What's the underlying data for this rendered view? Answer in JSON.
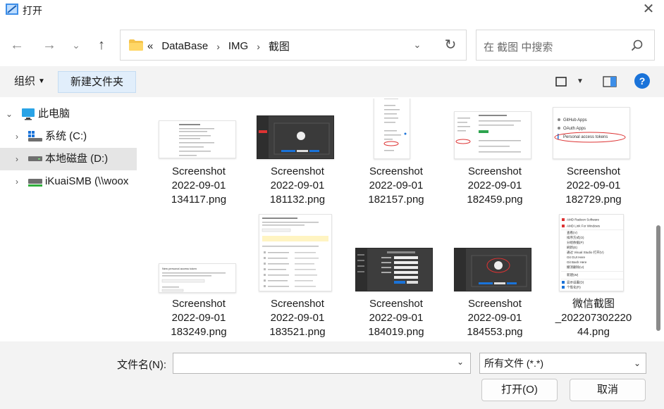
{
  "window": {
    "title": "打开",
    "close_glyph": "✕"
  },
  "nav_buttons": {
    "back": "←",
    "forward": "→",
    "recent": "⌄",
    "up": "↑"
  },
  "address": {
    "overflow": "«",
    "crumbs": [
      "DataBase",
      "IMG",
      "截图"
    ],
    "separator": "›",
    "refresh": "↻"
  },
  "search": {
    "placeholder": "在 截图 中搜索"
  },
  "toolbar": {
    "organize": "组织",
    "new_folder": "新建文件夹",
    "help": "?"
  },
  "sidebar": {
    "items": [
      {
        "label": "此电脑",
        "icon": "monitor-icon",
        "expanded": true
      },
      {
        "label": "系统 (C:)",
        "icon": "windows-drive-icon"
      },
      {
        "label": "本地磁盘 (D:)",
        "icon": "drive-icon",
        "selected": true
      },
      {
        "label": "iKuaiSMB (\\\\woox",
        "icon": "network-drive-icon"
      }
    ],
    "arrow_expanded": "⌄",
    "arrow_collapsed": "›"
  },
  "files": [
    {
      "name": "Screenshot\n2022-09-01\n134117.png",
      "style": "light-form"
    },
    {
      "name": "Screenshot\n2022-09-01\n181132.png",
      "style": "dark-dialog"
    },
    {
      "name": "Screenshot\n2022-09-01\n182157.png",
      "style": "menu-list"
    },
    {
      "name": "Screenshot\n2022-09-01\n182459.png",
      "style": "light-settings"
    },
    {
      "name": "Screenshot\n2022-09-01\n182729.png",
      "style": "github-menu"
    },
    {
      "name": "Screenshot\n2022-09-01\n183249.png",
      "style": "light-token"
    },
    {
      "name": "Screenshot\n2022-09-01\n183521.png",
      "style": "light-long"
    },
    {
      "name": "Screenshot\n2022-09-01\n184019.png",
      "style": "dark-form"
    },
    {
      "name": "Screenshot\n2022-09-01\n184553.png",
      "style": "dark-dialog"
    },
    {
      "name": "微信截图\n_202207302220\n44.png",
      "style": "context-menu"
    }
  ],
  "thumb_text": {
    "github_apps": "GitHub Apps",
    "oauth_apps": "OAuth Apps",
    "personal_tokens": "Personal access tokens",
    "token_title": "New personal access token",
    "ctx_menu": [
      "AMD Radeon Software",
      "AMD Link For Windows",
      "查看(V)",
      "排序方式(O)",
      "分组依据(P)",
      "刷新(E)",
      "通过 Visual Studio 打开(V)",
      "Git GUI Here",
      "Git Bash Here",
      "撤消删除(U)",
      "新建(W)",
      "显示设置(D)",
      "个性化(R)"
    ]
  },
  "bottom": {
    "filename_label": "文件名(N):",
    "filename_value": "",
    "filetype": "所有文件 (*.*)",
    "open_button": "打开(O)",
    "cancel_button": "取消"
  },
  "colors": {
    "accent": "#1a73d9",
    "toolbar_bg": "#f3f3f3",
    "selected_bg": "#e5e5e5",
    "new_folder_bg": "#e1eefb"
  }
}
